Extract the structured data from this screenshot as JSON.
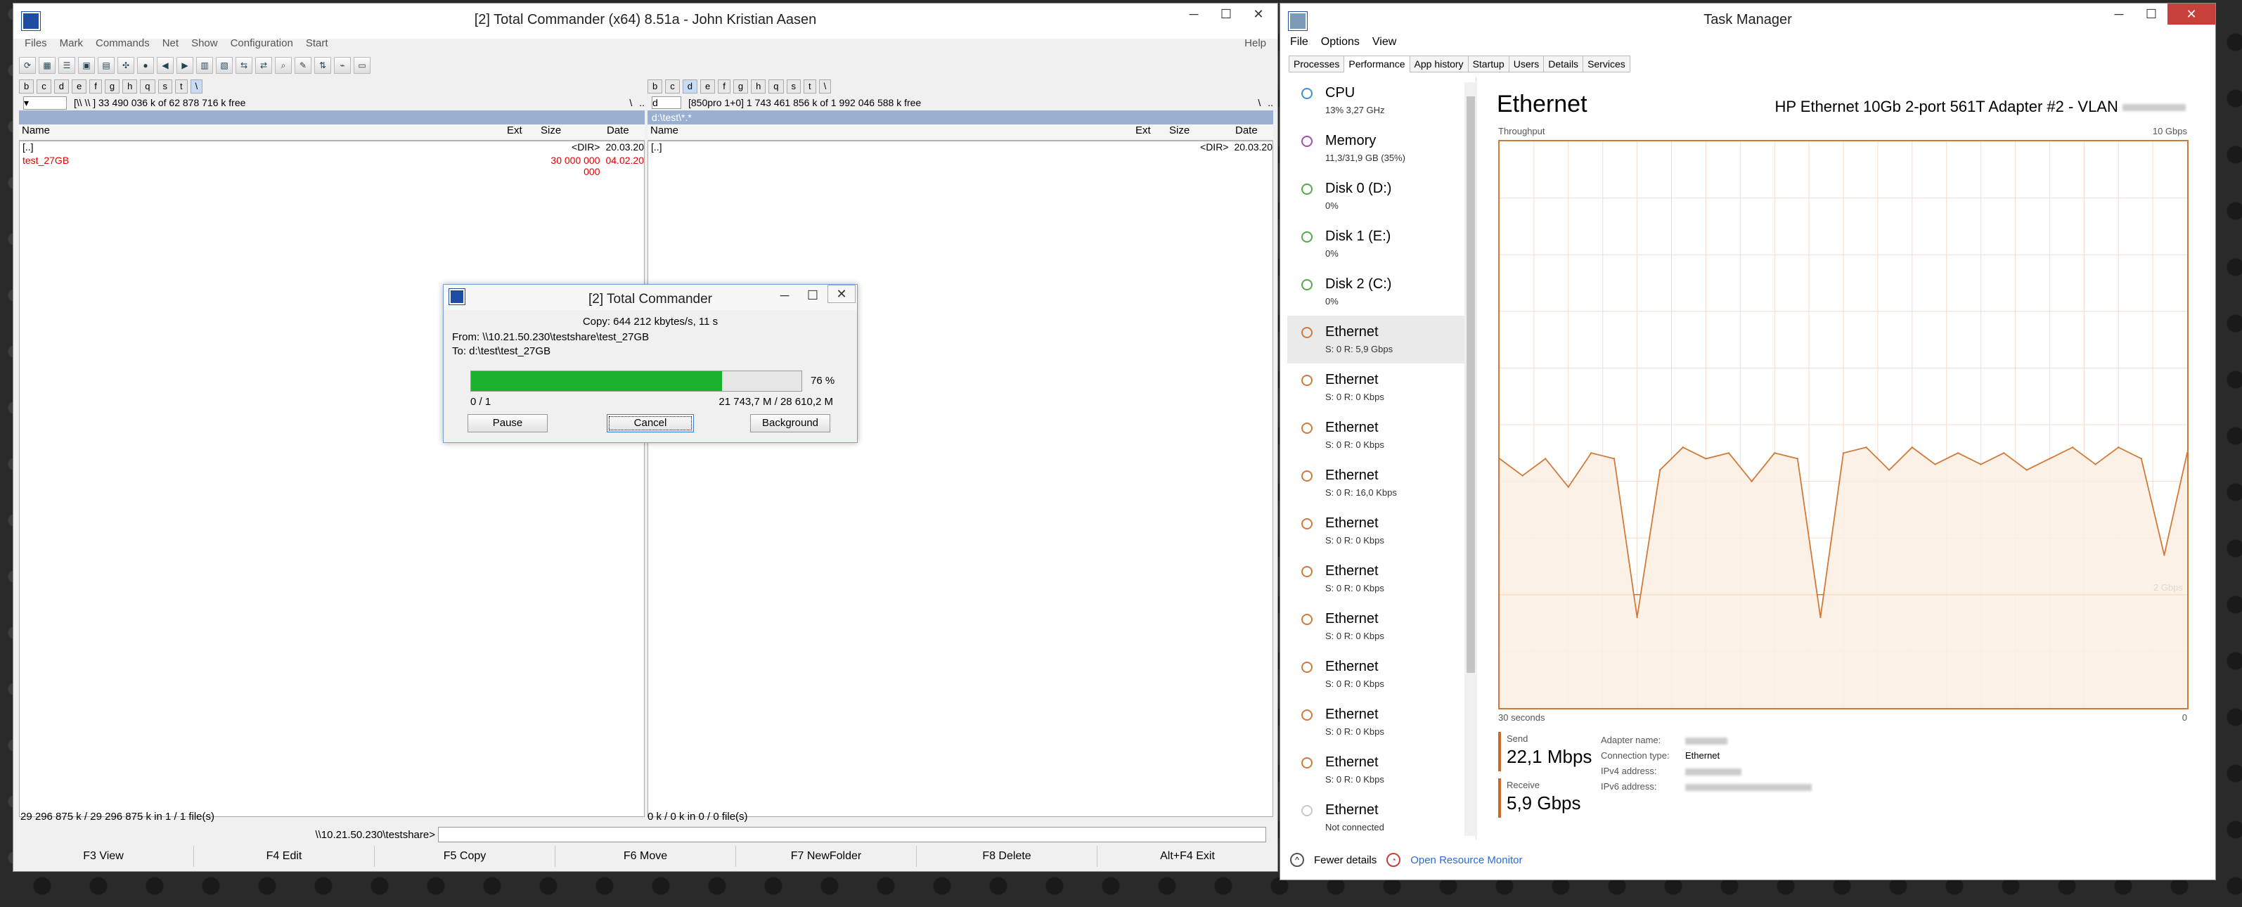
{
  "tc": {
    "title": "[2] Total Commander (x64) 8.51a - John Kristian Aasen",
    "menu": [
      "Files",
      "Mark",
      "Commands",
      "Net",
      "Show",
      "Configuration",
      "Start"
    ],
    "menu_help": "Help",
    "left": {
      "drives": [
        "b",
        "c",
        "d",
        "e",
        "f",
        "g",
        "h",
        "q",
        "s",
        "t",
        "\\"
      ],
      "drive_selected": "\\",
      "volume_info": "[\\\\ \\\\ ]  33 490 036 k of 62 878 716 k free",
      "path_up": "\\",
      "path_dots": "..",
      "path_star": "*",
      "columns": [
        "Name",
        "Ext",
        "Size",
        "Date"
      ],
      "rows": [
        {
          "name": "[..]",
          "ext": "",
          "size": "<DIR>",
          "date": "20.03.20",
          "red": false
        },
        {
          "name": "test_27GB",
          "ext": "",
          "size": "30 000 000 000",
          "date": "04.02.20",
          "red": true
        }
      ],
      "status": "29 296 875 k / 29 296 875 k in 1 / 1 file(s)"
    },
    "right": {
      "drives": [
        "b",
        "c",
        "d",
        "e",
        "f",
        "g",
        "h",
        "q",
        "s",
        "t",
        "\\"
      ],
      "drive_selected": "d",
      "drive_combo": "d",
      "volume_info": "[850pro 1+0]  1 743 461 856 k of 1 992 046 588 k free",
      "path_up": "\\",
      "path_dots": "..",
      "path_star": "*",
      "current_path": "d:\\test\\*.*",
      "columns": [
        "Name",
        "Ext",
        "Size",
        "Date"
      ],
      "rows": [
        {
          "name": "[..]",
          "ext": "",
          "size": "<DIR>",
          "date": "20.03.20",
          "red": false
        }
      ],
      "status": "0 k / 0 k in 0 / 0 file(s)"
    },
    "cmd_label": "\\\\10.21.50.230\\testshare>",
    "fkeys": [
      "F3 View",
      "F4 Edit",
      "F5 Copy",
      "F6 Move",
      "F7 NewFolder",
      "F8 Delete",
      "Alt+F4 Exit"
    ]
  },
  "dialog": {
    "title": "[2] Total Commander",
    "copy_line": "Copy: 644 212 kbytes/s, 11 s",
    "from": "From: \\\\10.21.50.230\\testshare\\test_27GB",
    "to": "To:  d:\\test\\test_27GB",
    "progress_percent": 76,
    "progress_label": "76 %",
    "files": "0 / 1",
    "amount": "21 743,7 M / 28 610,2 M",
    "pause": "Pause",
    "cancel": "Cancel",
    "background": "Background"
  },
  "tm": {
    "title": "Task Manager",
    "menu": [
      "File",
      "Options",
      "View"
    ],
    "tabs": [
      "Processes",
      "Performance",
      "App history",
      "Startup",
      "Users",
      "Details",
      "Services"
    ],
    "active_tab": "Performance",
    "sidebar": [
      {
        "title": "CPU",
        "sub": "13% 3,27 GHz",
        "color": "#3c8fd8"
      },
      {
        "title": "Memory",
        "sub": "11,3/31,9 GB (35%)",
        "color": "#a64ab0"
      },
      {
        "title": "Disk 0 (D:)",
        "sub": "0%",
        "color": "#58a84a"
      },
      {
        "title": "Disk 1 (E:)",
        "sub": "0%",
        "color": "#58a84a"
      },
      {
        "title": "Disk 2 (C:)",
        "sub": "0%",
        "color": "#58a84a"
      },
      {
        "title": "Ethernet",
        "sub": "S: 0 R: 5,9 Gbps",
        "color": "#d07a3a"
      },
      {
        "title": "Ethernet",
        "sub": "S: 0 R: 0 Kbps",
        "color": "#d07a3a"
      },
      {
        "title": "Ethernet",
        "sub": "S: 0 R: 0 Kbps",
        "color": "#d07a3a"
      },
      {
        "title": "Ethernet",
        "sub": "S: 0 R: 16,0 Kbps",
        "color": "#d07a3a"
      },
      {
        "title": "Ethernet",
        "sub": "S: 0 R: 0 Kbps",
        "color": "#d07a3a"
      },
      {
        "title": "Ethernet",
        "sub": "S: 0 R: 0 Kbps",
        "color": "#d07a3a"
      },
      {
        "title": "Ethernet",
        "sub": "S: 0 R: 0 Kbps",
        "color": "#d07a3a"
      },
      {
        "title": "Ethernet",
        "sub": "S: 0 R: 0 Kbps",
        "color": "#d07a3a"
      },
      {
        "title": "Ethernet",
        "sub": "S: 0 R: 0 Kbps",
        "color": "#d07a3a"
      },
      {
        "title": "Ethernet",
        "sub": "S: 0 R: 0 Kbps",
        "color": "#d07a3a"
      },
      {
        "title": "Ethernet",
        "sub": "Not connected",
        "color": "#c8c8c8"
      }
    ],
    "selected_index": 5,
    "heading": "Ethernet",
    "adapter": "HP Ethernet 10Gb 2-port 561T Adapter #2 - VLAN",
    "throughput_label": "Throughput",
    "max_label": "10 Gbps",
    "mid_label": "2 Gbps",
    "time_left": "30 seconds",
    "time_right": "0",
    "send_label": "Send",
    "send_value": "22,1 Mbps",
    "receive_label": "Receive",
    "receive_value": "5,9 Gbps",
    "info": [
      {
        "k": "Adapter name:",
        "v": ""
      },
      {
        "k": "Connection type:",
        "v": "Ethernet"
      },
      {
        "k": "IPv4 address:",
        "v": ""
      },
      {
        "k": "IPv6 address:",
        "v": ""
      }
    ],
    "fewer": "Fewer details",
    "resmon": "Open Resource Monitor"
  },
  "chart_data": {
    "type": "area",
    "xlabel": "",
    "ylabel": "Throughput",
    "x": [
      30,
      29,
      28,
      27,
      26,
      25,
      24,
      23,
      22,
      21,
      20,
      19,
      18,
      17,
      16,
      15,
      14,
      13,
      12,
      11,
      10,
      9,
      8,
      7,
      6,
      5,
      4,
      3,
      2,
      1,
      0
    ],
    "series": [
      {
        "values": [
          4.4,
          4.1,
          4.4,
          3.9,
          4.5,
          4.4,
          1.6,
          4.2,
          4.6,
          4.4,
          4.5,
          4.0,
          4.5,
          4.4,
          1.6,
          4.5,
          4.6,
          4.2,
          4.6,
          4.3,
          4.5,
          4.3,
          4.5,
          4.2,
          4.4,
          4.6,
          4.3,
          4.6,
          4.4,
          2.7,
          4.5
        ]
      }
    ],
    "ylim": [
      0,
      10
    ],
    "grid": true,
    "color": "#d07a3a",
    "fill": "#fbeee3"
  }
}
